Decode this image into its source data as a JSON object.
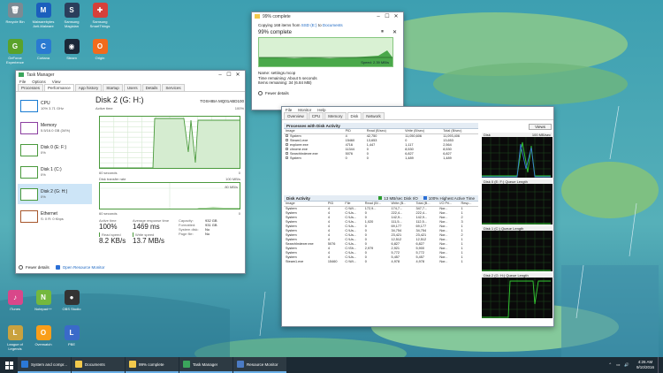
{
  "desktop": {
    "icons": [
      {
        "label": "Recycle Bin",
        "glyph": "🗑",
        "color": "#7d8a93"
      },
      {
        "label": "Malwarebytes Anti-Malware",
        "glyph": "M",
        "color": "#1b5fbd"
      },
      {
        "label": "Samsung Magician",
        "glyph": "S",
        "color": "#2b3e5c"
      },
      {
        "label": "Samsung SmartThings",
        "glyph": "✚",
        "color": "#d6403a"
      },
      {
        "label": "GeForce Experience",
        "glyph": "G",
        "color": "#5aa22a"
      },
      {
        "label": "Cortana",
        "glyph": "C",
        "color": "#2a7ad1"
      },
      {
        "label": "Steam",
        "glyph": "◉",
        "color": "#1b2838"
      },
      {
        "label": "Origin",
        "glyph": "O",
        "color": "#f26b1d"
      },
      {
        "label": "iTunes",
        "glyph": "♪",
        "color": "#d9478a"
      },
      {
        "label": "Notepad++",
        "glyph": "N",
        "color": "#74b83e"
      },
      {
        "label": "OBS Studio",
        "glyph": "●",
        "color": "#333333"
      },
      {
        "label": "League of Legends",
        "glyph": "L",
        "color": "#c9a23f"
      },
      {
        "label": "Overwatch",
        "glyph": "O",
        "color": "#f99e1a"
      },
      {
        "label": "PBE",
        "glyph": "L",
        "color": "#3a6ac9"
      }
    ]
  },
  "copy_dialog": {
    "title": "99% complete",
    "description_prefix": "Copying 168 items from",
    "from": "SSD (E:)",
    "to_word": "to",
    "to": "Documents",
    "percent_text": "99% complete",
    "speed": "Speed: 2.39 MB/s",
    "name": "Name: settings.mcop",
    "time_remaining": "Time remaining: About 5 seconds",
    "items_remaining": "Items remaining: 34 (6.84 MB)",
    "fewer_details": "Fewer details",
    "progress": 0.99
  },
  "task_manager": {
    "title": "Task Manager",
    "menu": [
      "File",
      "Options",
      "View"
    ],
    "tabs": [
      "Processes",
      "Performance",
      "App history",
      "Startup",
      "Users",
      "Details",
      "Services"
    ],
    "active_tab": "Performance",
    "sidebar": [
      {
        "name": "CPU",
        "detail": "10% 3.71 GHz",
        "color": "#1a7bd2"
      },
      {
        "name": "Memory",
        "detail": "5.5/16.0 GB (34%)",
        "color": "#8b3fa0"
      },
      {
        "name": "Disk 0 (E: F:)",
        "detail": "0%",
        "color": "#4a9a3c"
      },
      {
        "name": "Disk 1 (C:)",
        "detail": "0%",
        "color": "#4a9a3c"
      },
      {
        "name": "Disk 2 (G: H:)",
        "detail": "0%",
        "color": "#4a9a3c"
      },
      {
        "name": "Ethernet",
        "detail": "S: 0 R: 0 Kbps",
        "color": "#a6562b"
      }
    ],
    "disk_title": "Disk 2 (G: H:)",
    "disk_model": "TOSHIBA MQ01ABD100",
    "active_time_label": "Active time",
    "active_time_max": "100%",
    "seconds_label": "60 seconds",
    "zero": "0",
    "transfer_label": "Disk transfer rate",
    "transfer_max": "100 MB/s",
    "transfer_mid": "80 MB/s",
    "stats": {
      "active_time_k": "Active time",
      "active_time_v": "100%",
      "response_k": "Average response time",
      "response_v": "1469 ms",
      "read_k": "Read speed",
      "read_v": "8.2 KB/s",
      "write_k": "Write speed",
      "write_v": "13.7 MB/s"
    },
    "props": [
      {
        "k": "Capacity:",
        "v": "932 GB"
      },
      {
        "k": "Formatted:",
        "v": "931 GB"
      },
      {
        "k": "System disk:",
        "v": "No"
      },
      {
        "k": "Page file:",
        "v": "No"
      }
    ],
    "fewer_details": "Fewer details",
    "open_resmon": "Open Resource Monitor"
  },
  "resource_monitor": {
    "menu": [
      "File",
      "Monitor",
      "Help"
    ],
    "tabs": [
      "Overview",
      "CPU",
      "Memory",
      "Disk",
      "Network"
    ],
    "active_tab": "Disk",
    "views_label": "Views",
    "processes_section": "Processes with Disk Activity",
    "proc_headers": [
      "Image",
      "PID",
      "Read (B/sec)",
      "Write (B/sec)",
      "Total (B/sec)"
    ],
    "proc_rows": [
      [
        "System",
        "4",
        "42,750",
        "11,050,606",
        "11,093,406"
      ],
      [
        "Steam1.exe",
        "15460",
        "13,653",
        "0",
        "13,653"
      ],
      [
        "explorer.exe",
        "4716",
        "1,447",
        "1,117",
        "2,564"
      ],
      [
        "chrome.exe",
        "11344",
        "0",
        "8,530",
        "8,530"
      ],
      [
        "SearchIndexer.exe",
        "5076",
        "0",
        "6,827",
        "6,827"
      ],
      [
        "System",
        "0",
        "0",
        "1,489",
        "1,489"
      ]
    ],
    "disk_section": "Disk Activity",
    "disk_io": "13 MB/sec Disk I/O",
    "disk_active": "100% Highest Active Time",
    "disk_headers": [
      "Image",
      "PID",
      "File",
      "Read (B/...",
      "Write (B...",
      "Total (B...",
      "I/O Pri...",
      "Resp..."
    ],
    "disk_rows": [
      [
        "System",
        "4",
        "C:\\Wi...",
        "172,9...",
        "174,7...",
        "347,7...",
        "Nor...",
        "1"
      ],
      [
        "System",
        "4",
        "C:\\Us...",
        "0",
        "222,4...",
        "222,4...",
        "Nor...",
        "1"
      ],
      [
        "System",
        "4",
        "C:\\Us...",
        "0",
        "142,9...",
        "142,9...",
        "Nor...",
        "2"
      ],
      [
        "System",
        "4",
        "C:\\Us...",
        "1,020",
        "111,5...",
        "112,5...",
        "Nor...",
        "3"
      ],
      [
        "System",
        "4",
        "C:\\Us...",
        "0",
        "69,177",
        "69,177",
        "Nor...",
        "1"
      ],
      [
        "System",
        "4",
        "C:\\Us...",
        "0",
        "34,754",
        "34,754",
        "Nor...",
        "1"
      ],
      [
        "System",
        "4",
        "C:\\Us...",
        "0",
        "23,421",
        "23,421",
        "Nor...",
        "2"
      ],
      [
        "System",
        "4",
        "C:\\Us...",
        "0",
        "12,512",
        "12,512",
        "Nor...",
        "1"
      ],
      [
        "SearchIndexer.exe",
        "5076",
        "C:\\Us...",
        "0",
        "6,827",
        "6,827",
        "Nor...",
        "1"
      ],
      [
        "System",
        "4",
        "C:\\Sh...",
        "2,979",
        "2,921",
        "5,900",
        "Nor...",
        "1"
      ],
      [
        "System",
        "4",
        "C:\\Us...",
        "0",
        "5,772",
        "5,772",
        "Nor...",
        "1"
      ],
      [
        "System",
        "4",
        "C:\\Us...",
        "0",
        "5,457",
        "5,457",
        "Nor...",
        "1"
      ],
      [
        "Steam1.exe",
        "15460",
        "C:\\Wi...",
        "0",
        "4,978",
        "4,978",
        "Nor...",
        "1"
      ]
    ],
    "right_graphs": [
      {
        "title": "Disk",
        "scale": "100 MB/sec"
      },
      {
        "title": "Disk 0 (E: F:) Queue Length",
        "scale": ""
      },
      {
        "title": "Disk 1 (C:) Queue Length",
        "scale": ""
      },
      {
        "title": "Disk 2 (G: H:) Queue Length",
        "scale": ""
      }
    ]
  },
  "taskbar": {
    "apps": [
      {
        "label": "System and compr...",
        "color": "#2b78d6"
      },
      {
        "label": "Documents",
        "color": "#f2c94c"
      },
      {
        "label": "99% complete",
        "color": "#f2c94c"
      },
      {
        "label": "Task Manager",
        "color": "#3ba55c"
      },
      {
        "label": "Resource Monitor",
        "color": "#4b7bc4"
      }
    ],
    "time": "4:26 AM",
    "date": "9/10/2016"
  }
}
